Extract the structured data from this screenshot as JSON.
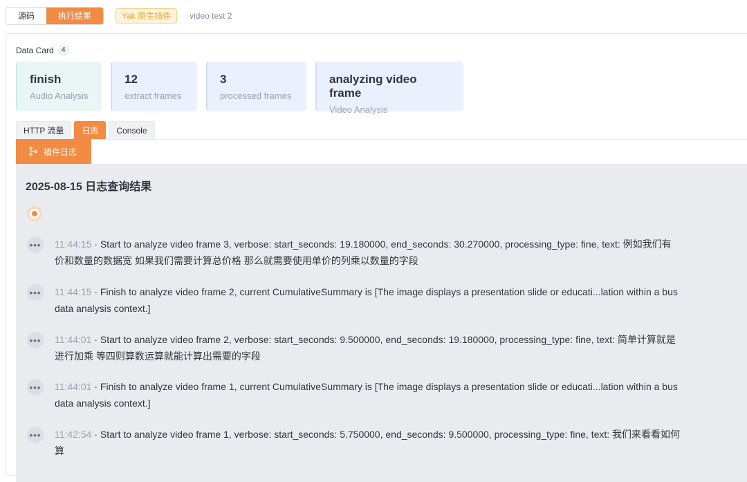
{
  "topbar": {
    "source_label": "源码",
    "result_label": "执行结果",
    "plugin_tag": "Yak 原生插件",
    "plugin_name": "video test 2"
  },
  "data_card": {
    "title": "Data Card",
    "count": "4",
    "cards": [
      {
        "value": "finish",
        "label": "Audio Analysis"
      },
      {
        "value": "12",
        "label": "extract frames"
      },
      {
        "value": "3",
        "label": "processed frames"
      },
      {
        "value": "analyzing video frame",
        "label": "Video Analysis"
      }
    ]
  },
  "tabs": [
    {
      "label": "HTTP 流量",
      "active": false
    },
    {
      "label": "日志",
      "active": true
    },
    {
      "label": "Console",
      "active": false
    }
  ],
  "subtab": {
    "label": "插件日志",
    "icon": "branch-icon"
  },
  "log": {
    "heading": "2025-08-15 日志查询结果",
    "entries": [
      {
        "time": "11:44:15",
        "line1": " · Start to analyze video frame 3, verbose: start_seconds: 19.180000, end_seconds: 30.270000, processing_type: fine, text: 例如我们有",
        "line2": "价和数量的数据宽 如果我们需要计算总价格 那么就需要使用单价的列乘以数量的字段"
      },
      {
        "time": "11:44:15",
        "line1": " · Finish to analyze video frame 2, current CumulativeSummary is [The image displays a presentation slide or educati...lation within a bus",
        "line2": "data analysis context.]"
      },
      {
        "time": "11:44:01",
        "line1": " · Start to analyze video frame 2, verbose: start_seconds: 9.500000, end_seconds: 19.180000, processing_type: fine, text: 简单计算就是",
        "line2": "进行加乘 等四则算数运算就能计算出需要的字段"
      },
      {
        "time": "11:44:01",
        "line1": " · Finish to analyze video frame 1, current CumulativeSummary is [The image displays a presentation slide or educati...lation within a bus",
        "line2": "data analysis context.]"
      },
      {
        "time": "11:42:54",
        "line1": " · Start to analyze video frame 1, verbose: start_seconds: 5.750000, end_seconds: 9.500000, processing_type: fine, text: 我们来看看如何",
        "line2": "算"
      }
    ]
  },
  "colors": {
    "accent": "#f28b44",
    "plugin_tag_text": "#e8a43a",
    "log_bg": "#eaebee"
  }
}
